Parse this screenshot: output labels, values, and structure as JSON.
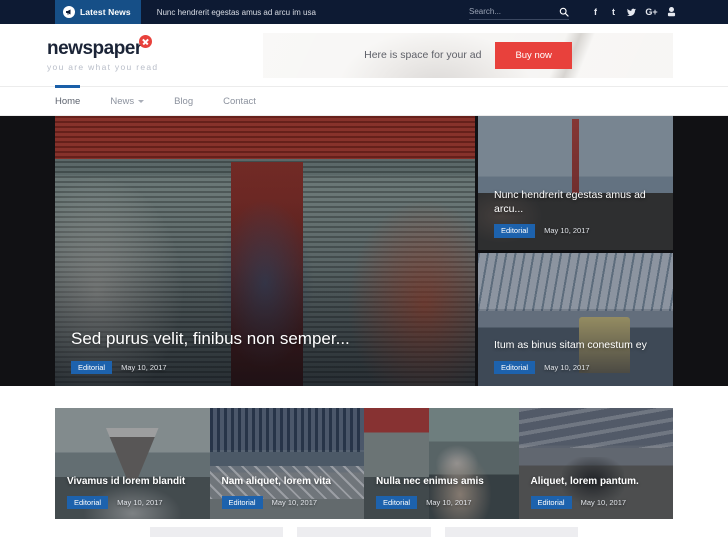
{
  "topbar": {
    "latest_news_label": "Latest News",
    "megaphone_icon": "megaphone-icon",
    "ticker_text": "Nunc hendrerit egestas amus ad arcu im usa",
    "search": {
      "placeholder": "Search...",
      "value": "",
      "icon": "search-icon"
    },
    "socials": [
      {
        "name": "facebook-icon",
        "glyph": "f"
      },
      {
        "name": "tumblr-icon",
        "glyph": "t"
      },
      {
        "name": "twitter-icon",
        "glyph": "🐦"
      },
      {
        "name": "google-plus-icon",
        "glyph": "G+"
      },
      {
        "name": "youtube-icon",
        "glyph": "▶"
      }
    ]
  },
  "header": {
    "brand_name": "newspaper",
    "brand_icon": "x-circle-icon",
    "tagline": "you are what you read",
    "ad": {
      "text": "Here is space for your ad",
      "button_label": "Buy now",
      "button_color": "#e8413c"
    }
  },
  "nav": {
    "items": [
      {
        "label": "Home",
        "active": true,
        "has_dropdown": false
      },
      {
        "label": "News",
        "active": false,
        "has_dropdown": true
      },
      {
        "label": "Blog",
        "active": false,
        "has_dropdown": false
      },
      {
        "label": "Contact",
        "active": false,
        "has_dropdown": false
      }
    ],
    "active_indicator_color": "#1a5fa8"
  },
  "hero": {
    "background_color": "#111114",
    "main": {
      "title": "Sed purus velit, finibus non semper...",
      "category": "Editorial",
      "date": "May 10, 2017",
      "image": "street-musician-photo"
    },
    "side": [
      {
        "title": "Nunc hendrerit egestas amus ad arcu...",
        "category": "Editorial",
        "date": "May 10, 2017",
        "image": "golden-gate-bridge-photo"
      },
      {
        "title": "Itum as binus sitam conestum ey",
        "category": "Editorial",
        "date": "May 10, 2017",
        "image": "train-station-photo"
      }
    ]
  },
  "cards": [
    {
      "title": "Vivamus id lorem blandit",
      "category": "Editorial",
      "date": "May 10, 2017",
      "image": "coffee-pourover-photo"
    },
    {
      "title": "Nam aliquet, lorem vita",
      "category": "Editorial",
      "date": "May 10, 2017",
      "image": "city-bridge-photo"
    },
    {
      "title": "Nulla nec enimus amis",
      "category": "Editorial",
      "date": "May 10, 2017",
      "image": "street-walker-photo"
    },
    {
      "title": "Aliquet, lorem pantum.",
      "category": "Editorial",
      "date": "May 10, 2017",
      "image": "mountain-viewer-photo"
    }
  ],
  "badge_color": "#1d62ad"
}
